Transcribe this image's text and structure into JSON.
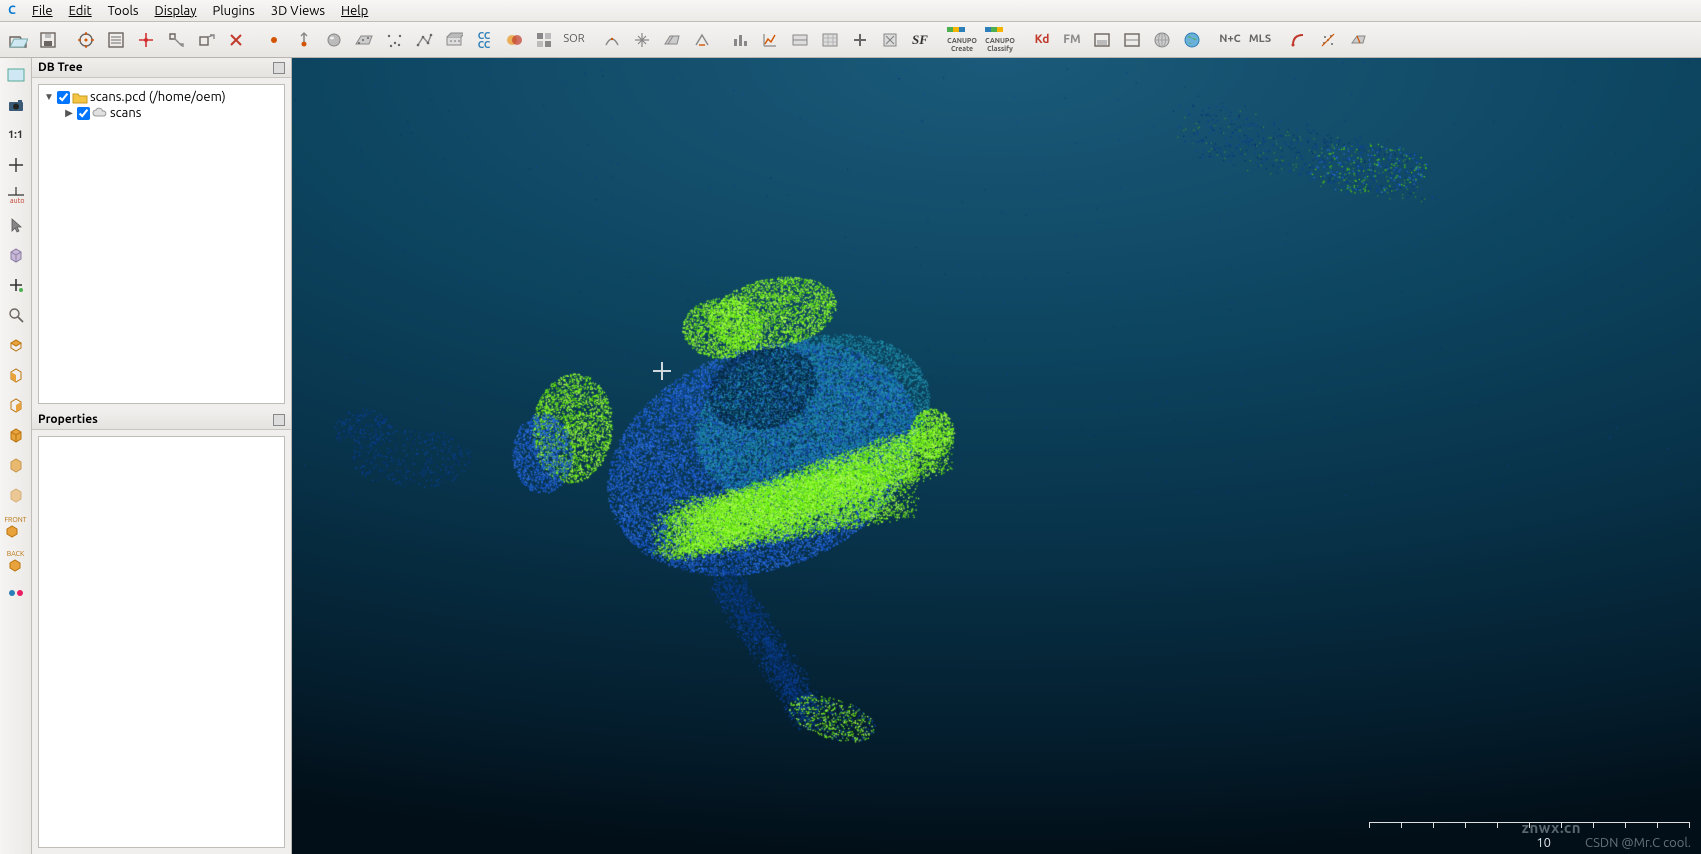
{
  "app": {
    "logo_letter": "C"
  },
  "menubar": {
    "items": [
      {
        "label": "File",
        "ul": 0
      },
      {
        "label": "Edit",
        "ul": 0
      },
      {
        "label": "Tools",
        "ul": -1
      },
      {
        "label": "Display",
        "ul": 0
      },
      {
        "label": "Plugins",
        "ul": -1
      },
      {
        "label": "3D Views",
        "ul": -1
      },
      {
        "label": "Help",
        "ul": 0
      }
    ]
  },
  "toolbar": {
    "groups": [
      [
        "open-icon",
        "save-icon"
      ],
      [
        "pick-rotation-center-icon",
        "properties-list-icon",
        "point-picking-icon",
        "segment-icon",
        "translate-rotate-icon",
        "delete-icon"
      ],
      [
        "point-icon",
        "normal-icon",
        "sphere-icon",
        "plane-icon",
        "polyline-picking-icon",
        "trace-polyline-icon",
        "section-icon",
        "clone-icon",
        "merge-icon",
        "subsample-icon",
        "sor-icon"
      ],
      [
        "curvature-icon",
        "register-icon",
        "align-icon",
        "level-icon"
      ],
      [
        "histogram-icon",
        "stats-icon",
        "fit-plane-icon",
        "fit-sphere-icon",
        "cross-icon",
        "delete-scalar-icon",
        "sf-icon"
      ],
      [
        "canupo-create-icon",
        "canupo-classify-icon"
      ],
      [
        "kd-icon",
        "fm-icon",
        "tool-a-icon",
        "tool-b-icon",
        "globe-gray-icon",
        "globe-blue-icon"
      ],
      [
        "nplusc-icon",
        "mls-icon"
      ],
      [
        "ransac-icon",
        "tool-c-icon",
        "tool-d-icon"
      ]
    ],
    "text_labels": {
      "sor": "SOR",
      "sf": "SF",
      "kd": "Kd",
      "fm": "FM",
      "nplusc": "N+C",
      "mls": "MLS",
      "canupo_create": "CANUPO\nCreate",
      "canupo_classify": "CANUPO\nClassify",
      "cc": "CC\nCC"
    }
  },
  "left_strip": {
    "items": [
      "view-frame-icon",
      "camera-icon",
      "one-to-one-icon",
      "plus-icon",
      "auto-pick-icon",
      "cursor-icon",
      "cube-shade-icon",
      "plus-small-icon",
      "zoom-icon",
      "view-top-icon",
      "view-front-icon",
      "view-side-icon",
      "view-iso1-icon",
      "view-iso2-icon",
      "view-iso3-icon",
      "front-label-icon",
      "back-label-icon",
      "flickr-dots-icon"
    ],
    "labels": {
      "one_to_one": "1:1",
      "front": "FRONT",
      "back": "BACK",
      "auto": "auto"
    }
  },
  "panels": {
    "dbtree": {
      "title": "DB Tree",
      "root": {
        "expanded": true,
        "checked": true,
        "icon": "folder",
        "label": "scans.pcd (/home/oem)",
        "children": [
          {
            "expanded": false,
            "checked": true,
            "icon": "cloud",
            "label": "scans"
          }
        ]
      }
    },
    "properties": {
      "title": "Properties"
    }
  },
  "viewport": {
    "scale_value": "10",
    "watermark1": "znwx.cn",
    "watermark2": "CSDN @Mr.C cool."
  }
}
